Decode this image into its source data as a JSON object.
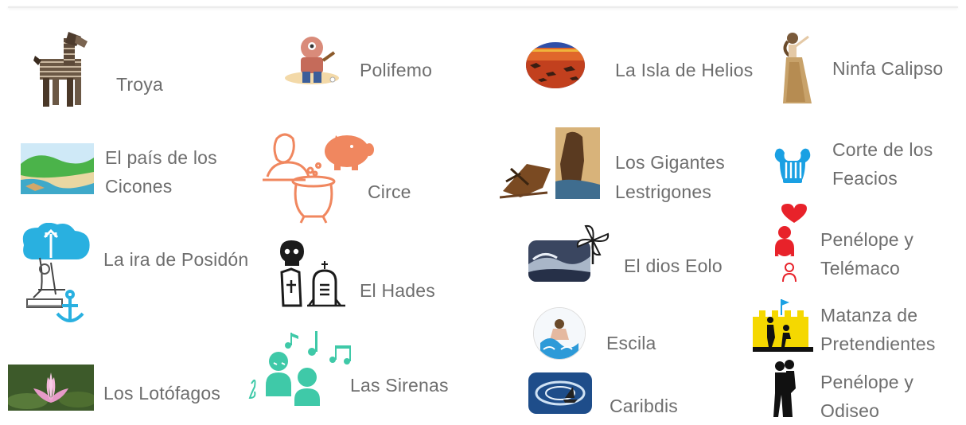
{
  "items": [
    {
      "id": "troya",
      "label": "Troya"
    },
    {
      "id": "polifemo",
      "label": "Polifemo"
    },
    {
      "id": "helios",
      "label": "La Isla de Helios"
    },
    {
      "id": "calipso",
      "label": "Ninfa Calipso"
    },
    {
      "id": "cicones",
      "line1": "El país de los",
      "line2": "Cicones"
    },
    {
      "id": "circe",
      "label": "Circe"
    },
    {
      "id": "lestrigones",
      "line1": "Los Gigantes",
      "line2": "Lestrigones"
    },
    {
      "id": "feacios",
      "line1": "Corte de los",
      "line2": "Feacios"
    },
    {
      "id": "posidon",
      "label": "La ira de Posidón"
    },
    {
      "id": "hades",
      "label": "El Hades"
    },
    {
      "id": "eolo",
      "label": "El dios Eolo"
    },
    {
      "id": "penelope_telemaco",
      "line1": "Penélope y",
      "line2": "Telémaco"
    },
    {
      "id": "escila",
      "label": "Escila"
    },
    {
      "id": "matanza",
      "line1": "Matanza de",
      "line2": "Pretendientes"
    },
    {
      "id": "lotofagos",
      "label": "Los Lotófagos"
    },
    {
      "id": "sirenas",
      "label": "Las Sirenas"
    },
    {
      "id": "caribdis",
      "label": "Caribdis"
    },
    {
      "id": "penelope_odiseo",
      "line1": "Penélope y",
      "line2": "Odiseo"
    }
  ],
  "colors": {
    "text": "#6e6e6e",
    "orange": "#f0875f",
    "teal": "#3fc9a8",
    "blue": "#2ea8dc",
    "red": "#e8222a",
    "yellow": "#f5d800"
  }
}
